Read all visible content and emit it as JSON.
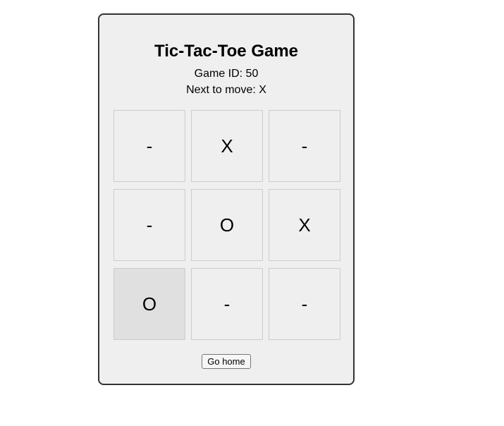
{
  "game": {
    "title": "Tic-Tac-Toe Game",
    "game_id_text": "Game ID: 50",
    "next_move_text": "Next to move: X"
  },
  "board": {
    "cells": [
      {
        "value": "-"
      },
      {
        "value": "X"
      },
      {
        "value": "-"
      },
      {
        "value": "-"
      },
      {
        "value": "O"
      },
      {
        "value": "X"
      },
      {
        "value": "O",
        "highlighted": true
      },
      {
        "value": "-"
      },
      {
        "value": "-"
      }
    ]
  },
  "actions": {
    "home_label": "Go home"
  },
  "colors": {
    "panel_background": "#efefef",
    "panel_border": "#333333",
    "cell_border": "#cccccc",
    "highlight_cell": "#e0e0e0"
  }
}
